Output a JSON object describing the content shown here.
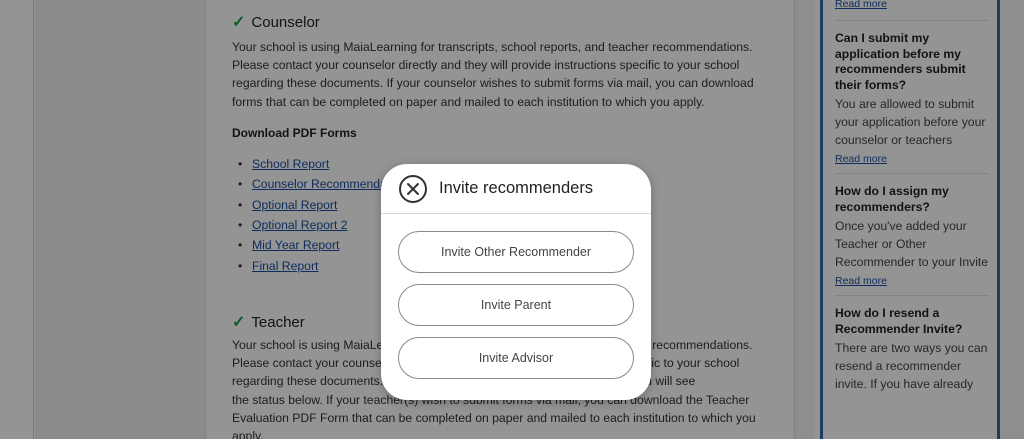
{
  "counselor": {
    "title": "Counselor",
    "paragraph_lines": [
      "Your school is using MaiaLearning for transcripts, school reports, and teacher recommendations.",
      "Please contact your counselor directly and they will provide instructions specific to your school",
      "regarding these documents. If your counselor wishes to submit forms via mail, you can download",
      "forms that can be completed on paper and mailed to each institution to which you apply."
    ],
    "download_title": "Download PDF Forms",
    "pdf_links": [
      "School Report",
      "Counselor Recommendation",
      "Optional Report",
      "Optional Report 2",
      "Mid Year Report",
      "Final Report"
    ]
  },
  "teacher": {
    "title": "Teacher",
    "paragraph_lines": [
      "Your school is using MaiaLearning for transcripts, school reports, and teacher recommendations.",
      "Please contact your counselor directly and they will provide instructions specific to your school",
      "regarding these documents. If your teacher(s) wish to submit forms online you will see",
      "the status below. If your teacher(s) wish to submit forms via mail, you can download the Teacher",
      "Evaluation PDF Form that can be completed on paper and mailed to each institution to which you",
      "apply."
    ]
  },
  "faq": {
    "top_read_more": "Read more",
    "items": [
      {
        "question": "Can I submit my application before my recommenders submit their forms?",
        "answer": "You are allowed to submit your application before your counselor or teachers submit their school forms.",
        "read_more": "Read more"
      },
      {
        "question": "How do I assign my recommenders?",
        "answer": "Once you've added your Teacher or Other Recommender to your Invite and Manage",
        "read_more": "Read more"
      },
      {
        "question": "How do I resend a Recommender Invite?",
        "answer": "There are two ways you can resend a recommender invite. If you have already",
        "read_more": ""
      }
    ]
  },
  "modal": {
    "title": "Invite recommenders",
    "close_icon": "close-circle-icon",
    "buttons": [
      "Invite Other Recommender",
      "Invite Parent",
      "Invite Advisor"
    ]
  },
  "colors": {
    "accent_blue": "#2b6cb0",
    "link_blue": "#1a4fa0",
    "check_green": "#1e9e4a",
    "overlay": "rgba(0,0,0,0.42)"
  }
}
